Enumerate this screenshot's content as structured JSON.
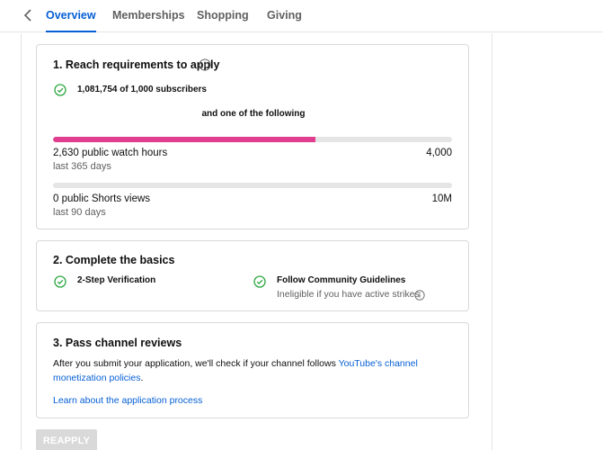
{
  "tabs": [
    {
      "label": "Overview",
      "active": true
    },
    {
      "label": "Memberships",
      "active": false
    },
    {
      "label": "Shopping",
      "active": false
    },
    {
      "label": "Giving",
      "active": false
    }
  ],
  "colors": {
    "accent": "#065fd4",
    "progress": "#e13e8f",
    "success": "#2ba640"
  },
  "requirements": {
    "title": "1. Reach requirements to apply",
    "subscribers": "1,081,754 of 1,000 subscribers",
    "or_text": "and one of the following",
    "watch_hours": {
      "label": "2,630 public watch hours",
      "sub": "last 365 days",
      "target": "4,000",
      "progress_fraction": 0.6575
    },
    "shorts": {
      "label": "0 public Shorts views",
      "sub": "last 90 days",
      "target": "10M",
      "progress_fraction": 0
    }
  },
  "basics": {
    "title": "2. Complete the basics",
    "two_step": "2-Step Verification",
    "guidelines": "Follow Community Guidelines",
    "guidelines_sub": "Ineligible if you have active strikes"
  },
  "reviews": {
    "title": "3. Pass channel reviews",
    "text_before": "After you submit your application, we'll check if your channel follows ",
    "policy_link": "YouTube's channel monetization policies",
    "text_after": ".",
    "learn_link": "Learn about the application process"
  },
  "reapply_label": "REAPPLY"
}
